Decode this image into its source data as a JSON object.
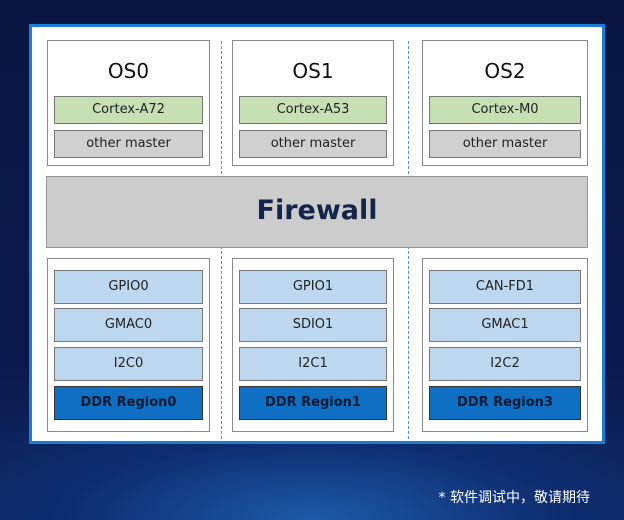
{
  "columns": [
    {
      "os": "OS0",
      "core": "Cortex-A72",
      "master": "other master",
      "peripherals": [
        "GPIO0",
        "GMAC0",
        "I2C0"
      ],
      "ddr": "DDR Region0"
    },
    {
      "os": "OS1",
      "core": "Cortex-A53",
      "master": "other master",
      "peripherals": [
        "GPIO1",
        "SDIO1",
        "I2C1"
      ],
      "ddr": "DDR Region1"
    },
    {
      "os": "OS2",
      "core": "Cortex-M0",
      "master": "other master",
      "peripherals": [
        "CAN-FD1",
        "GMAC1",
        "I2C2"
      ],
      "ddr": "DDR Region3"
    }
  ],
  "firewall": "Firewall",
  "note": "* 软件调试中，敬请期待",
  "colors": {
    "core": "#c6e0b4",
    "master": "#d0d0d0",
    "peripheral": "#bdd7ee",
    "ddr": "#0f6fc2",
    "border": "#1a7fd4"
  }
}
